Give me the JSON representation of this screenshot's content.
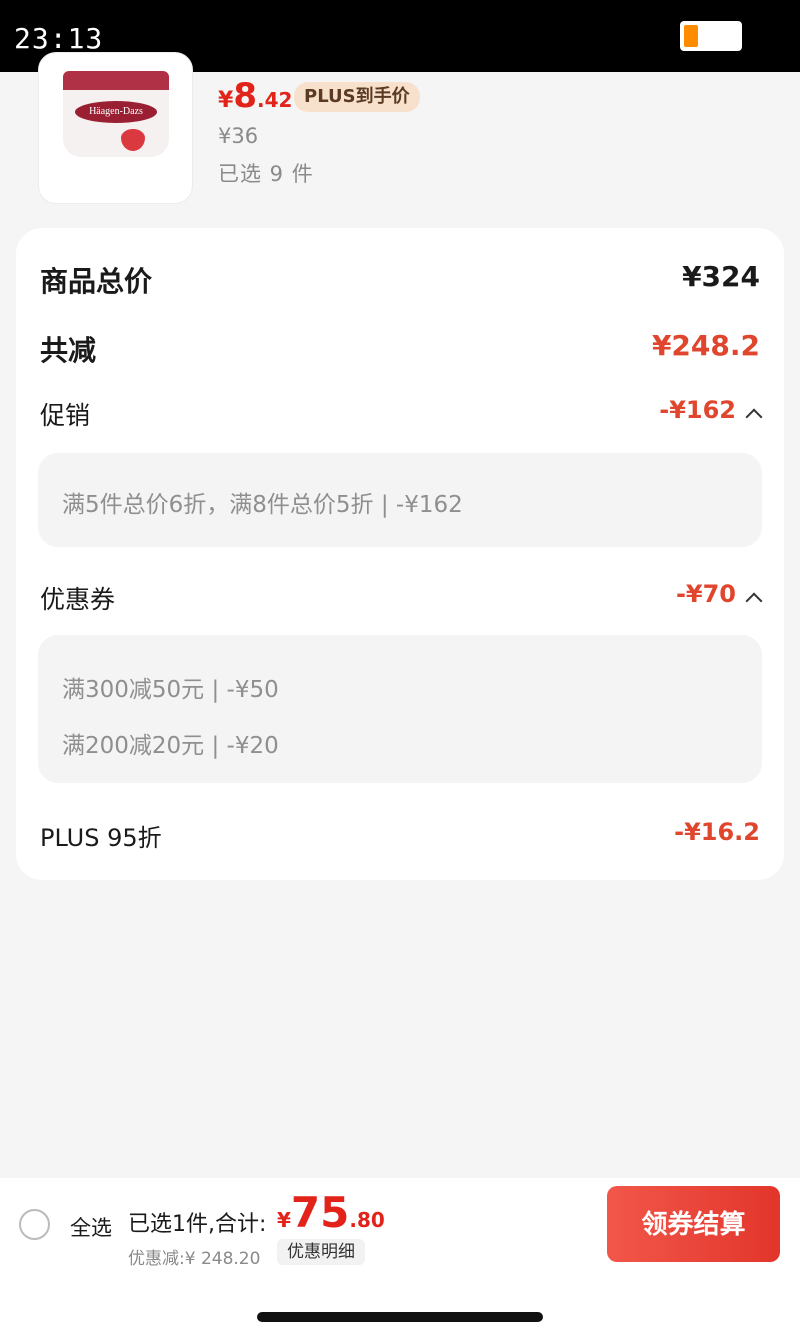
{
  "status_bar": {
    "time": "23:13"
  },
  "product": {
    "image_label": "Häagen-Dazs",
    "price_symbol": "¥",
    "price_int": "8",
    "price_dec": ".42",
    "plus_tag": "PLUS到手价",
    "original_price": "¥36",
    "selected_qty": "已选 9 件"
  },
  "summary": {
    "total_label": "商品总价",
    "total_value": "¥324",
    "reduce_label": "共减",
    "reduce_value": "¥248.2",
    "promo_label": "促销",
    "promo_value": "-¥162",
    "promo_detail": "满5件总价6折，满8件总价5折 | -¥162",
    "coupon_label": "优惠券",
    "coupon_value": "-¥70",
    "coupon_details": [
      "满300减50元 | -¥50",
      "满200减20元 | -¥20"
    ],
    "plus_label": "PLUS 95折",
    "plus_value": "-¥16.2"
  },
  "footer": {
    "select_all": "全选",
    "selected_text": "已选1件,合计:",
    "total_symbol": "¥",
    "total_int": "75",
    "total_dec": ".80",
    "discount_text": "优惠减:¥ 248.20",
    "detail_button": "优惠明细",
    "checkout_button": "领券结算"
  },
  "colors": {
    "accent": "#e2231a",
    "discount": "#e0452d",
    "plus_tag_bg": "#f7e1cc"
  }
}
